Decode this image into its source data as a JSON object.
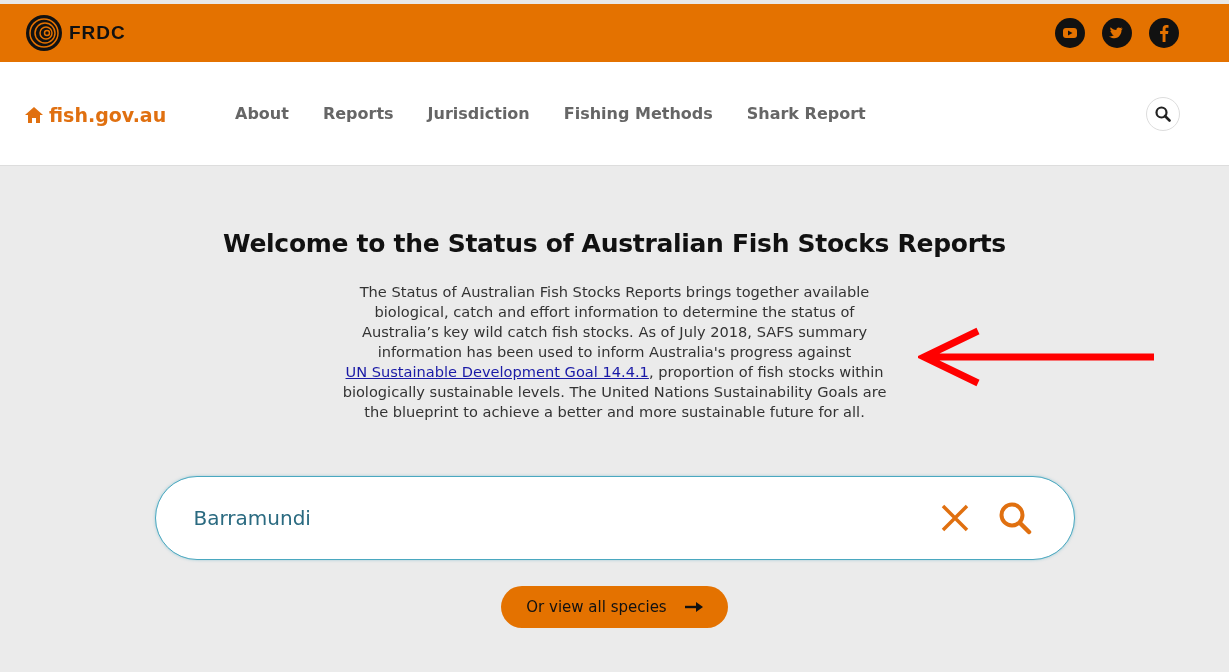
{
  "top_bar": {
    "logo_text": "FRDC"
  },
  "nav": {
    "home": "fish.gov.au",
    "items": [
      "About",
      "Reports",
      "Jurisdiction",
      "Fishing Methods",
      "Shark Report"
    ]
  },
  "hero": {
    "title": "Welcome to the Status of Australian Fish Stocks Reports",
    "intro_before": "The Status of Australian Fish Stocks Reports brings together available biological, catch and effort information to determine the status of Australia’s key wild catch fish stocks. As of July 2018, SAFS summary information has been used to inform Australia's progress against ",
    "intro_link": "UN Sustainable Development Goal 14.4.1",
    "intro_after": ", proportion of fish stocks within biologically sustainable levels. The United Nations Sustainability Goals are the blueprint to achieve a better and more sustainable future for all."
  },
  "search": {
    "value": "Barramundi"
  },
  "view_all_button": "Or view all species"
}
